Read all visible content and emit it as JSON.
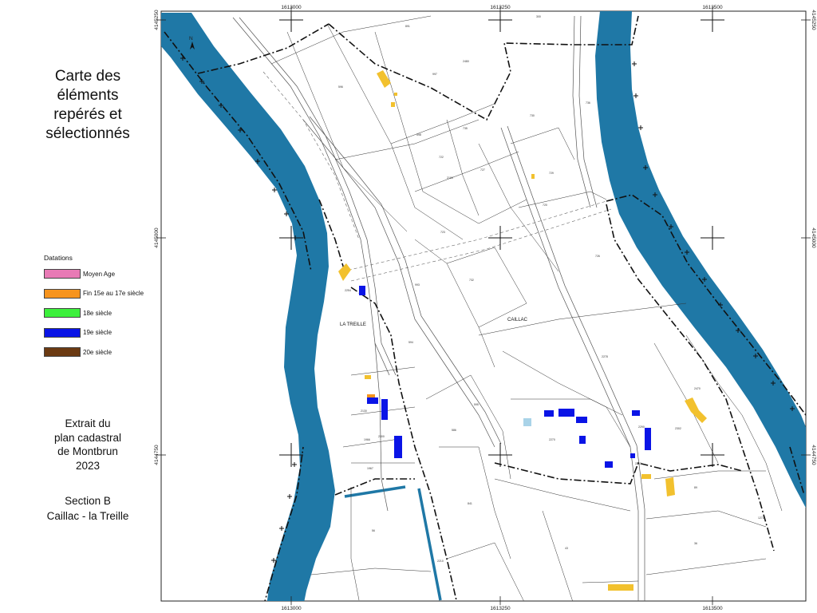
{
  "title": "Carte des\néléments\nrepérés et\nsélectionnés",
  "legend": {
    "title": "Datations",
    "items": [
      {
        "label": "Moyen Age",
        "color": "#e87ab5"
      },
      {
        "label": "Fin 15e au 17e siècle",
        "color": "#f7941d"
      },
      {
        "label": "18e siècle",
        "color": "#3cf03c"
      },
      {
        "label": "19e siècle",
        "color": "#0a14e6"
      },
      {
        "label": "20e siècle",
        "color": "#6b3a12"
      }
    ]
  },
  "extract": "Extrait du\nplan cadastral\nde Montbrun\n2023",
  "section": "Section B\nCaillac - la Treille",
  "map": {
    "coords_x": [
      "1613000",
      "1613250",
      "1613500"
    ],
    "coords_y": [
      "4145250",
      "4145000",
      "4144750"
    ],
    "places": [
      "LA TREILLE",
      "CAILLAC"
    ],
    "north": "N",
    "plots": [
      "300",
      "891",
      "2480",
      "596",
      "997",
      "730",
      "736",
      "735",
      "2190",
      "727",
      "729",
      "598",
      "723",
      "722",
      "993",
      "2270",
      "594",
      "732",
      "720",
      "726",
      "2278",
      "2254",
      "2130",
      "2300",
      "1966",
      "1967",
      "595",
      "586",
      "841",
      "2470",
      "2290",
      "2302",
      "2253",
      "89",
      "43",
      "56",
      "36",
      "1272",
      "2210"
    ],
    "colors": {
      "water": "#1f78a6",
      "highlight": "#f2c12e",
      "building19": "#0a14e6",
      "faded": "#a9d3e8"
    }
  }
}
